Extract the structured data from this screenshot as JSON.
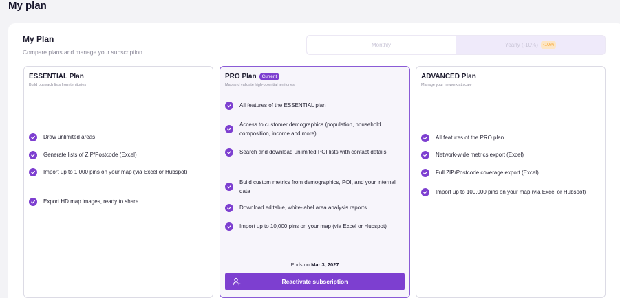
{
  "page": {
    "title": "My plan"
  },
  "plan_card": {
    "title": "My Plan",
    "subtitle": "Compare plans and manage your subscription"
  },
  "billing_toggle": {
    "monthly_label": "Monthly",
    "yearly_label": "Yearly (-10%)",
    "yearly_badge": "-10%",
    "selected": "Yearly (-10%)"
  },
  "plans": [
    {
      "name": "ESSENTIAL Plan",
      "description": "Build outreach lists from territories",
      "features": [
        "Draw unlimited areas",
        "Generate lists of ZIP/Postcode (Excel)",
        "Import up to 1,000 pins on your map (via Excel or Hubspot)",
        "Export HD map images, ready to share"
      ]
    },
    {
      "name": "PRO Plan",
      "badge": "Current",
      "description": "Map and validate high-potential territories",
      "features": [
        "All features of the ESSENTIAL plan",
        "Access to customer demographics (population, household composition, income and more)",
        "Search and download unlimited POI lists with contact details",
        "Build custom metrics from demographics, POI, and your internal data",
        "Download editable, white-label area analysis reports",
        "Import up to 10,000 pins on your map (via Excel or Hubspot)"
      ],
      "ends_prefix": "Ends on",
      "ends_date": "Mar 3, 2027",
      "action_label": "Reactivate subscription"
    },
    {
      "name": "ADVANCED Plan",
      "description": "Manage your network at scale",
      "features": [
        "All features of the PRO plan",
        "Network-wide metrics export (Excel)",
        "Full ZIP/Postcode coverage export (Excel)",
        "Import up to 100,000 pins on your map (via Excel or Hubspot)"
      ]
    }
  ],
  "colors": {
    "accent": "#7d3fd0",
    "current_border": "#8a5bd6",
    "discount": "#f5a535"
  }
}
